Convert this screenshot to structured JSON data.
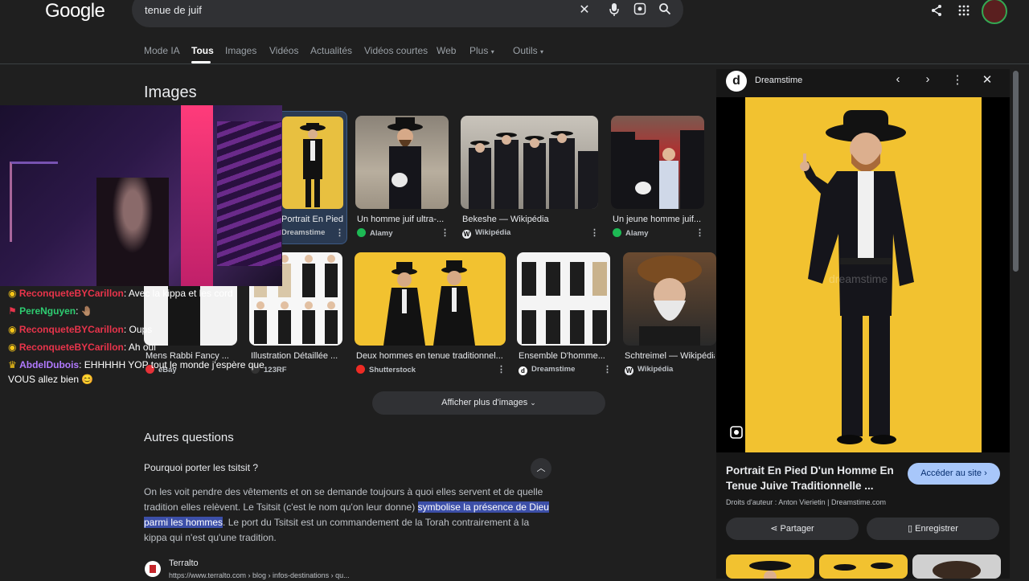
{
  "header": {
    "logo": "Google",
    "search_value": "tenue de juif",
    "icons": [
      "close-icon",
      "mic-icon",
      "lens-icon",
      "search-icon",
      "share-icon",
      "apps-icon",
      "avatar"
    ]
  },
  "tabs": [
    {
      "label": "Mode IA"
    },
    {
      "label": "Tous",
      "active": true
    },
    {
      "label": "Images"
    },
    {
      "label": "Vidéos"
    },
    {
      "label": "Actualités"
    },
    {
      "label": "Vidéos courtes"
    },
    {
      "label": "Web"
    },
    {
      "label": "Plus"
    },
    {
      "label": "Outils"
    }
  ],
  "images_section": {
    "title": "Images",
    "row1": [
      {
        "caption": "Portrait En Pied D'un...",
        "source": "Dreamstime"
      },
      {
        "caption": "Un homme juif ultra-...",
        "source": "Alamy"
      },
      {
        "caption": "Bekeshe — Wikipédia",
        "source": "Wikipédia"
      },
      {
        "caption": "Un jeune homme juif...",
        "source": "Alamy"
      }
    ],
    "row2": [
      {
        "caption": "Mens Rabbi Fancy ...",
        "source": "eBay"
      },
      {
        "caption": "Illustration Détaillée ...",
        "source": "123RF"
      },
      {
        "caption": "Deux hommes en tenue traditionnel...",
        "source": "Shutterstock"
      },
      {
        "caption": "Ensemble D'homme...",
        "source": "Dreamstime"
      },
      {
        "caption": "Schtreimel — Wikipédia",
        "source": "Wikipédia"
      }
    ],
    "more_button": "Afficher plus d'images"
  },
  "faq": {
    "title": "Autres questions",
    "question": "Pourquoi porter les tsitsit ?",
    "answer_part1": "On les voit pendre des vêtements et on se demande toujours à quoi elles servent et de quelle tradition elles relèvent. Le Tsitsit (c'est le nom qu'on leur donne) ",
    "answer_highlight": "symbolise la présence de Dieu parmi les hommes",
    "answer_part2": ". Le port du Tsitsit est un commandement de la Torah contrairement à la kippa qui n'est qu'une tradition.",
    "source_name": "Terralto",
    "source_url": "https://www.terralto.com › blog › infos-destinations › qu..."
  },
  "chat": [
    {
      "user": "ReconqueteBYCarillon",
      "msg": "Avec la kippa et les cord",
      "color": "#e8344b"
    },
    {
      "user": "PereNguyen",
      "msg": "🤚🏽",
      "color": "#2ecc71"
    },
    {
      "user": "ReconqueteBYCarillon",
      "msg": "Oups",
      "color": "#e8344b"
    },
    {
      "user": "ReconqueteBYCarillon",
      "msg": "Ah oui",
      "color": "#e8344b"
    },
    {
      "user": "AbdelDubois",
      "msg": "EHHHHH YOP tout le monde j'espère que",
      "msg2": "VOUS allez bien 😊",
      "color": "#b17aff"
    }
  ],
  "side_panel": {
    "logo": "d",
    "source": "Dreamstime",
    "title": "Portrait En Pied D'un Homme En Tenue Juive Traditionnelle ...",
    "visit_button": "Accéder au site",
    "rights": "Droits d'auteur : Anton Vierietin | Dreamstime.com",
    "share_button": "Partager",
    "save_button": "Enregistrer",
    "watermark": "dreamstime",
    "icons": [
      "prev-icon",
      "next-icon",
      "more-icon",
      "close-icon",
      "lens-icon"
    ]
  },
  "colors": {
    "background": "#1f1f1f",
    "accent": "#a8c7fa",
    "highlight": "#3c4fa8",
    "yellow_backdrop": "#f2c230"
  }
}
